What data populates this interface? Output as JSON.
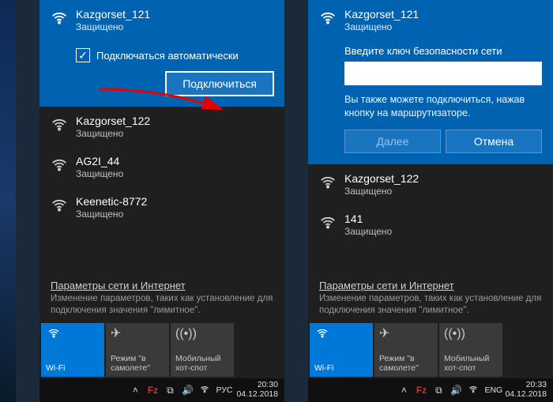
{
  "left": {
    "selected": {
      "name": "Kazgorset_121",
      "status": "Защищено",
      "auto_label": "Подключаться автоматически",
      "connect": "Подключиться"
    },
    "others": [
      {
        "name": "Kazgorset_122",
        "status": "Защищено"
      },
      {
        "name": "AG2I_44",
        "status": "Защищено"
      },
      {
        "name": "Keenetic-8772",
        "status": "Защищено"
      }
    ],
    "settings_link": "Параметры сети и Интернет",
    "settings_sub": "Изменение параметров, таких как установление для подключения значения \"лимитное\".",
    "tiles": {
      "wifi": "Wi-Fi",
      "airplane": "Режим \"в самолете\"",
      "hotspot": "Мобильный хот-спот"
    },
    "tray": {
      "lang": "РУС",
      "time": "20:30",
      "date": "04.12.2018"
    }
  },
  "right": {
    "selected": {
      "name": "Kazgorset_121",
      "status": "Защищено",
      "pwd_label": "Введите ключ безопасности сети",
      "hint": "Вы также можете подключиться, нажав кнопку на маршрутизаторе.",
      "next": "Далее",
      "cancel": "Отмена"
    },
    "others": [
      {
        "name": "Kazgorset_122",
        "status": "Защищено"
      },
      {
        "name": "141",
        "status": "Защищено"
      }
    ],
    "settings_link": "Параметры сети и Интернет",
    "settings_sub": "Изменение параметров, таких как установление для подключения значения \"лимитное\".",
    "tiles": {
      "wifi": "Wi-Fi",
      "airplane": "Режим \"в самолете\"",
      "hotspot": "Мобильный хот-спот"
    },
    "tray": {
      "lang": "ENG",
      "time": "20:33",
      "date": "04.12.2018"
    }
  }
}
